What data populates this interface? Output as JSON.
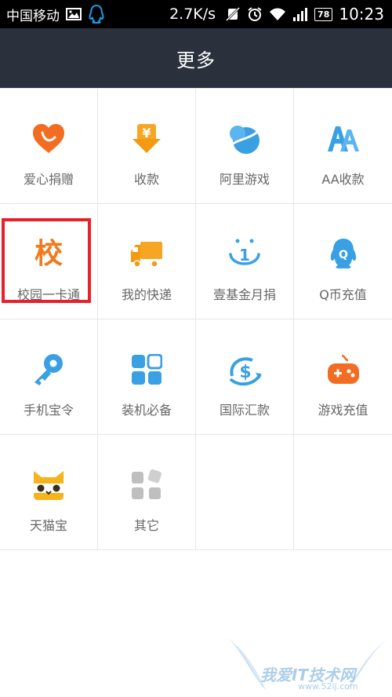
{
  "status_bar": {
    "carrier": "中国移动",
    "speed": "2.7K/s",
    "battery": "78",
    "time": "10:23"
  },
  "header": {
    "title": "更多"
  },
  "grid": {
    "items": [
      {
        "label": "爱心捐赠",
        "icon": "heart-donate-icon",
        "color": "#f26c22"
      },
      {
        "label": "收款",
        "icon": "yuan-receive-icon",
        "color": "#f6a623"
      },
      {
        "label": "阿里游戏",
        "icon": "ali-game-icon",
        "color": "#3aa0e4"
      },
      {
        "label": "AA收款",
        "icon": "aa-collect-icon",
        "color": "#3aa0e4"
      },
      {
        "label": "校园一卡通",
        "icon": "campus-card-icon",
        "icon_text": "校",
        "color": "#f07a1c",
        "highlighted": true
      },
      {
        "label": "我的快递",
        "icon": "delivery-truck-icon",
        "color": "#f6a623"
      },
      {
        "label": "壹基金月捐",
        "icon": "one-foundation-icon",
        "icon_text": "1",
        "color": "#3aa0e4"
      },
      {
        "label": "Q币充值",
        "icon": "qq-coin-icon",
        "icon_text": "Q",
        "color": "#3aa0e4"
      },
      {
        "label": "手机宝令",
        "icon": "key-token-icon",
        "color": "#3aa0e4"
      },
      {
        "label": "装机必备",
        "icon": "app-essentials-icon",
        "color": "#3aa0e4"
      },
      {
        "label": "国际汇款",
        "icon": "intl-remit-icon",
        "icon_text": "$",
        "color": "#3aa0e4"
      },
      {
        "label": "游戏充值",
        "icon": "gamepad-icon",
        "color": "#f26c22"
      },
      {
        "label": "天猫宝",
        "icon": "tmall-bao-icon",
        "color": "#f6b31b"
      },
      {
        "label": "其它",
        "icon": "others-icon",
        "color": "#bfbfbf"
      },
      {
        "label": "",
        "icon": "",
        "color": ""
      },
      {
        "label": "",
        "icon": "",
        "color": ""
      }
    ]
  },
  "watermark": {
    "text": "我爱IT技术网",
    "url": "www.52ij.com"
  }
}
